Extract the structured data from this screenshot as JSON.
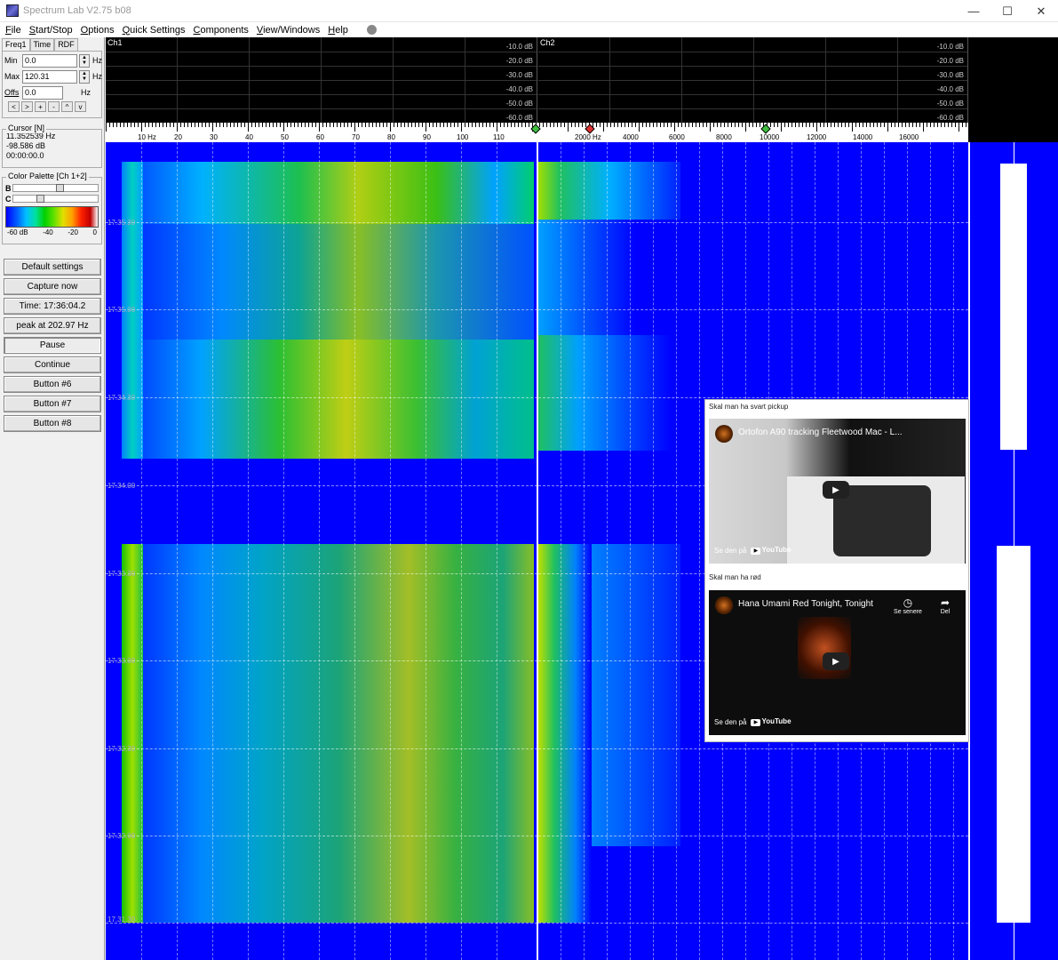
{
  "window": {
    "title": "Spectrum Lab V2.75 b08",
    "minimize": "—",
    "maximize": "☐",
    "close": "✕"
  },
  "menu": [
    {
      "u": "F",
      "rest": "ile"
    },
    {
      "u": "S",
      "rest": "tart/Stop"
    },
    {
      "u": "O",
      "rest": "ptions"
    },
    {
      "u": "Q",
      "rest": "uick Settings"
    },
    {
      "u": "C",
      "rest": "omponents"
    },
    {
      "u": "V",
      "rest": "iew/Windows"
    },
    {
      "u": "H",
      "rest": "elp"
    }
  ],
  "freq_panel": {
    "tabs": [
      "Freq1",
      "Time",
      "RDF"
    ],
    "min_label": "Min",
    "min_value": "0.0",
    "min_unit": "Hz",
    "max_label": "Max",
    "max_value": "120.31",
    "max_unit": "Hz",
    "offs_label": "Offs",
    "offs_value": "0.0",
    "offs_unit": "Hz",
    "nav_buttons": [
      "<",
      ">",
      "+",
      "-",
      "^",
      "v"
    ]
  },
  "cursor": {
    "title": "Cursor [N]",
    "freq": "11.352539 Hz",
    "level": "-98.586 dB",
    "time": "00:00:00.0"
  },
  "palette": {
    "title": "Color Palette [Ch 1+2]",
    "b_label": "B",
    "c_label": "C",
    "b_position": 0.55,
    "c_position": 0.3,
    "ticks": [
      "-60 dB",
      "-40",
      "-20",
      "0"
    ]
  },
  "buttons": [
    {
      "label": "Default settings",
      "pressed": false
    },
    {
      "label": "Capture now",
      "pressed": false
    },
    {
      "label": "Time:  17:36:04.2",
      "pressed": false
    },
    {
      "label": "peak at 202.97 Hz",
      "pressed": false
    },
    {
      "label": "Pause",
      "pressed": true
    },
    {
      "label": "Continue",
      "pressed": false
    },
    {
      "label": "Button #6",
      "pressed": false
    },
    {
      "label": "Button #7",
      "pressed": false
    },
    {
      "label": "Button #8",
      "pressed": false
    }
  ],
  "scopes": {
    "ch1_label": "Ch1",
    "ch2_label": "Ch2",
    "db_labels": [
      "-10.0 dB",
      "-20.0 dB",
      "-30.0 dB",
      "-40.0 dB",
      "-50.0 dB",
      "-60.0 dB"
    ]
  },
  "axis": {
    "ch1_ticks": [
      "10 Hz",
      "20",
      "30",
      "40",
      "50",
      "60",
      "70",
      "80",
      "90",
      "100",
      "110"
    ],
    "ch2_ticks": [
      "2000 Hz",
      "4000",
      "6000",
      "8000",
      "10000",
      "12000",
      "14000",
      "16000"
    ]
  },
  "time_labels": [
    "17.35.30",
    "17.35.00",
    "17.34.30",
    "17.34.00",
    "17.33.30",
    "17.33.00",
    "17.32.30",
    "17.32.00",
    "17.31.30"
  ],
  "popup": {
    "heading1": "Skal man ha svart pickup",
    "video1_title": "Ortofon A90 tracking Fleetwood Mac - L...",
    "heading2": "Skal man ha rød",
    "video2_title": "Hana Umami Red Tonight, Tonight",
    "watch_on": "Se den på",
    "youtube": "YouTube",
    "watch_later": "Se senere",
    "share": "Del"
  },
  "colors": {
    "spectrogram_bg": "#0000ff",
    "scope_bg": "#000000"
  }
}
